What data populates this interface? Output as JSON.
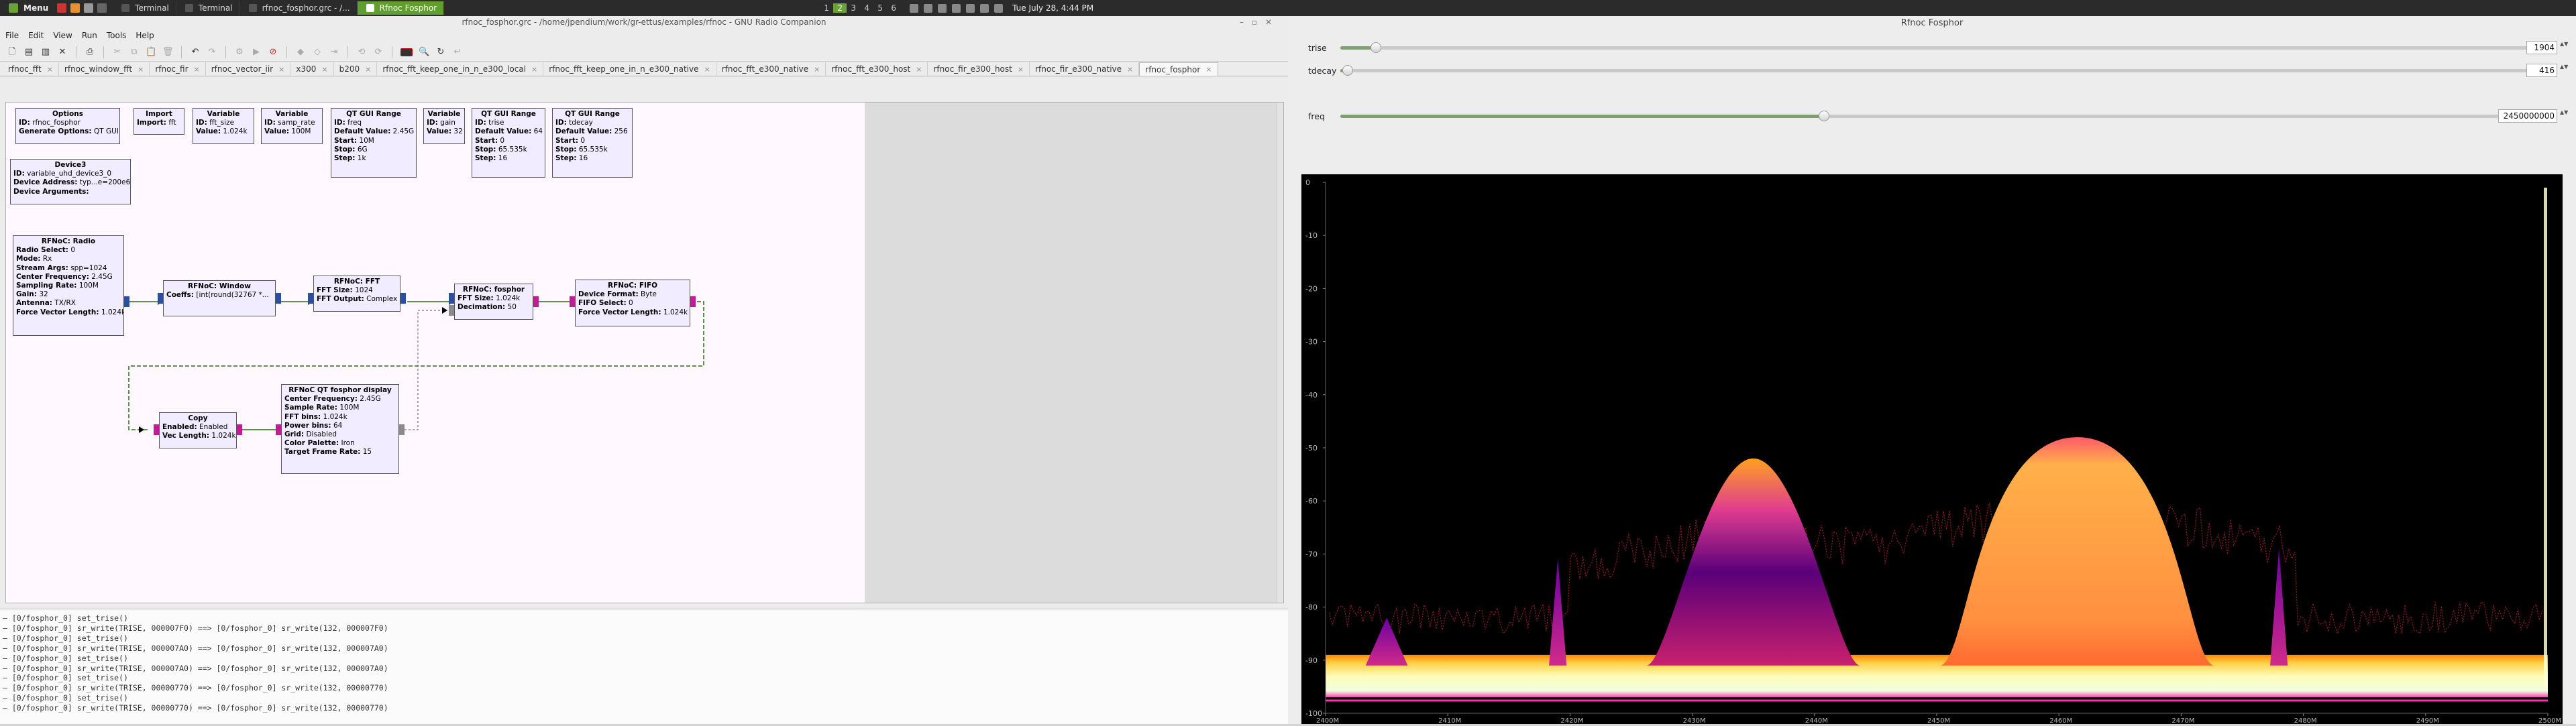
{
  "taskbar": {
    "menu_label": "Menu",
    "tasks": [
      {
        "label": "Terminal",
        "active": false
      },
      {
        "label": "Terminal",
        "active": false
      },
      {
        "label": "rfnoc_fosphor.grc - /...",
        "active": false
      },
      {
        "label": "Rfnoc Fosphor",
        "active": true
      }
    ],
    "workspaces": [
      "1",
      "2",
      "3",
      "4",
      "5",
      "6"
    ],
    "current_workspace": "2",
    "clock": "Tue July 28, 4:44 PM"
  },
  "grc": {
    "title": "rfnoc_fosphor.grc - /home/jpendium/work/gr-ettus/examples/rfnoc - GNU Radio Companion",
    "menus": [
      "File",
      "Edit",
      "View",
      "Run",
      "Tools",
      "Help"
    ],
    "tabs": [
      {
        "label": "rfnoc_fft",
        "active": false
      },
      {
        "label": "rfnoc_window_fft",
        "active": false
      },
      {
        "label": "rfnoc_fir",
        "active": false
      },
      {
        "label": "rfnoc_vector_iir",
        "active": false
      },
      {
        "label": "x300",
        "active": false
      },
      {
        "label": "b200",
        "active": false
      },
      {
        "label": "rfnoc_fft_keep_one_in_n_e300_local",
        "active": false
      },
      {
        "label": "rfnoc_fft_keep_one_in_n_e300_native",
        "active": false
      },
      {
        "label": "rfnoc_fft_e300_native",
        "active": false
      },
      {
        "label": "rfnoc_fft_e300_host",
        "active": false
      },
      {
        "label": "rfnoc_fir_e300_host",
        "active": false
      },
      {
        "label": "rfnoc_fir_e300_native",
        "active": false
      },
      {
        "label": "rfnoc_fosphor",
        "active": true
      }
    ],
    "blocks": {
      "options": {
        "title": "Options",
        "lines": [
          [
            "ID:",
            "rfnoc_fosphor"
          ],
          [
            "Generate Options:",
            "QT GUI"
          ]
        ]
      },
      "import": {
        "title": "Import",
        "lines": [
          [
            "Import:",
            "fft"
          ]
        ]
      },
      "var1": {
        "title": "Variable",
        "lines": [
          [
            "ID:",
            "fft_size"
          ],
          [
            "Value:",
            "1.024k"
          ]
        ]
      },
      "var2": {
        "title": "Variable",
        "lines": [
          [
            "ID:",
            "samp_rate"
          ],
          [
            "Value:",
            "100M"
          ]
        ]
      },
      "range1": {
        "title": "QT GUI Range",
        "lines": [
          [
            "ID:",
            "freq"
          ],
          [
            "Default Value:",
            "2.45G"
          ],
          [
            "Start:",
            "10M"
          ],
          [
            "Stop:",
            "6G"
          ],
          [
            "Step:",
            "1k"
          ]
        ]
      },
      "var3": {
        "title": "Variable",
        "lines": [
          [
            "ID:",
            "gain"
          ],
          [
            "Value:",
            "32"
          ]
        ]
      },
      "range2": {
        "title": "QT GUI Range",
        "lines": [
          [
            "ID:",
            "trise"
          ],
          [
            "Default Value:",
            "64"
          ],
          [
            "Start:",
            "0"
          ],
          [
            "Stop:",
            "65.535k"
          ],
          [
            "Step:",
            "16"
          ]
        ]
      },
      "range3": {
        "title": "QT GUI Range",
        "lines": [
          [
            "ID:",
            "tdecay"
          ],
          [
            "Default Value:",
            "256"
          ],
          [
            "Start:",
            "0"
          ],
          [
            "Stop:",
            "65.535k"
          ],
          [
            "Step:",
            "16"
          ]
        ]
      },
      "device3": {
        "title": "Device3",
        "lines": [
          [
            "ID:",
            "variable_uhd_device3_0"
          ],
          [
            "Device Address:",
            "typ...e=200e6"
          ],
          [
            "Device Arguments:",
            ""
          ]
        ]
      },
      "radio": {
        "title": "RFNoC: Radio",
        "lines": [
          [
            "Radio Select:",
            "0"
          ],
          [
            "Mode:",
            "Rx"
          ],
          [
            "Stream Args:",
            "spp=1024"
          ],
          [
            "Center Frequency:",
            "2.45G"
          ],
          [
            "Sampling Rate:",
            "100M"
          ],
          [
            "Gain:",
            "32"
          ],
          [
            "Antenna:",
            "TX/RX"
          ],
          [
            "Force Vector Length:",
            "1.024k"
          ]
        ]
      },
      "window": {
        "title": "RFNoC: Window",
        "lines": [
          [
            "Coeffs:",
            "[int(round(32767 *..."
          ]
        ]
      },
      "fft": {
        "title": "RFNoC: FFT",
        "lines": [
          [
            "FFT Size:",
            "1024"
          ],
          [
            "FFT Output:",
            "Complex"
          ]
        ]
      },
      "fosphor": {
        "title": "RFNoC: fosphor",
        "lines": [
          [
            "FFT Size:",
            "1.024k"
          ],
          [
            "Decimation:",
            "50"
          ]
        ]
      },
      "fifo": {
        "title": "RFNoC: FIFO",
        "lines": [
          [
            "Device Format:",
            "Byte"
          ],
          [
            "FIFO Select:",
            "0"
          ],
          [
            "Force Vector Length:",
            "1.024k"
          ]
        ]
      },
      "copy": {
        "title": "Copy",
        "lines": [
          [
            "Enabled:",
            "Enabled"
          ],
          [
            "Vec Length:",
            "1.024k"
          ]
        ]
      },
      "display": {
        "title": "RFNoC QT fosphor display",
        "lines": [
          [
            "Center Frequency:",
            "2.45G"
          ],
          [
            "Sample Rate:",
            "100M"
          ],
          [
            "FFT bins:",
            "1.024k"
          ],
          [
            "Power bins:",
            "64"
          ],
          [
            "Grid:",
            "Disabled"
          ],
          [
            "Color Palette:",
            "Iron"
          ],
          [
            "Target Frame Rate:",
            "15"
          ]
        ]
      }
    },
    "console_lines": [
      "– [0/fosphor_0] set_trise()",
      "– [0/fosphor_0] sr_write(TRISE, 000007F0) ==>  [0/fosphor_0] sr_write(132, 000007F0)",
      "– [0/fosphor_0] set_trise()",
      "– [0/fosphor_0] sr_write(TRISE, 000007A0) ==>  [0/fosphor_0] sr_write(132, 000007A0)",
      "– [0/fosphor_0] set_trise()",
      "– [0/fosphor_0] sr_write(TRISE, 000007A0) ==>  [0/fosphor_0] sr_write(132, 000007A0)",
      "– [0/fosphor_0] set_trise()",
      "– [0/fosphor_0] sr_write(TRISE, 00000770) ==>  [0/fosphor_0] sr_write(132, 00000770)",
      "– [0/fosphor_0] set_trise()",
      "– [0/fosphor_0] sr_write(TRISE, 00000770) ==>  [0/fosphor_0] sr_write(132, 00000770)"
    ]
  },
  "fosphor": {
    "title": "Rfnoc Fosphor",
    "sliders": [
      {
        "name": "trise",
        "label": "trise",
        "value": "1904",
        "fraction": 0.029
      },
      {
        "name": "tdecay",
        "label": "tdecay",
        "value": "416",
        "fraction": 0.006
      },
      {
        "name": "freq",
        "label": "freq",
        "value": "2450000000",
        "fraction": 0.409
      }
    ],
    "colors": {
      "accent": "#7d9f6d"
    }
  },
  "chart_data": {
    "type": "heatmap",
    "title": "",
    "xlabel": "",
    "ylabel": "",
    "y_ticks": [
      "0",
      "-10",
      "-20",
      "-30",
      "-40",
      "-50",
      "-60",
      "-70",
      "-80",
      "-90",
      "-100"
    ],
    "x_ticks": [
      "2400M",
      "2410M",
      "2420M",
      "2430M",
      "2440M",
      "2450M",
      "2460M",
      "2470M",
      "2480M",
      "2490M",
      "2500M"
    ],
    "xlim": [
      2400,
      2500
    ],
    "ylim": [
      -100,
      0
    ],
    "palette": "Iron",
    "noise_floor_db": -93,
    "signals": [
      {
        "center_mhz": 2435,
        "width_mhz": 14,
        "peak_db": -52
      },
      {
        "center_mhz": 2461.5,
        "width_mhz": 18,
        "peak_db": -48
      },
      {
        "center_mhz": 2405,
        "width_mhz": 3,
        "peak_db": -82
      },
      {
        "center_mhz": 2419,
        "width_mhz": 1,
        "peak_db": -71
      },
      {
        "center_mhz": 2478,
        "width_mhz": 1,
        "peak_db": -69
      }
    ]
  }
}
